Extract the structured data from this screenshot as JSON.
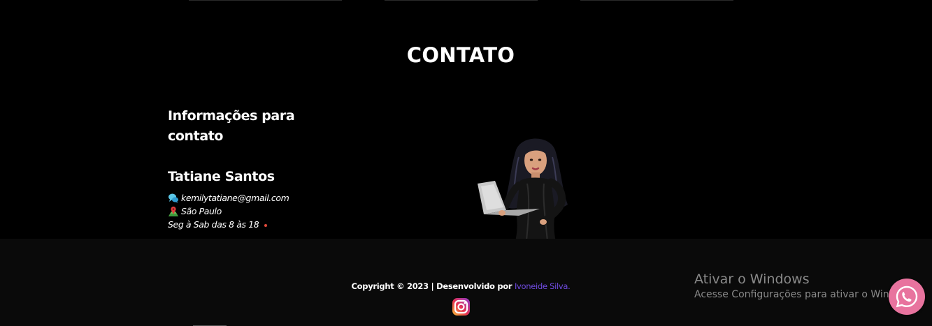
{
  "contact": {
    "title": "CONTATO",
    "heading": "Informações para contato",
    "name": "Tatiane Santos",
    "email": "kemilytatiane@gmail.com",
    "location": "São Paulo",
    "hours": "Seg à Sab das 8 às 18"
  },
  "footer": {
    "copyright": "Copyright © 2023 | Desenvolvido por",
    "developer": "Ivoneide Silva."
  },
  "windows_notice": {
    "title": "Ativar o Windows",
    "subtitle": "Acesse Configurações para ativar o Windows."
  },
  "icons": {
    "email": "speech-bubble-icon",
    "location": "map-pin-icon",
    "instagram": "instagram-icon",
    "whatsapp": "whatsapp-icon"
  },
  "colors": {
    "background": "#000000",
    "footer_bg": "#0a0a0a",
    "developer_link": "#6f4be0",
    "whatsapp_bg": "#e8739e",
    "status_dot": "#e24a3a"
  }
}
